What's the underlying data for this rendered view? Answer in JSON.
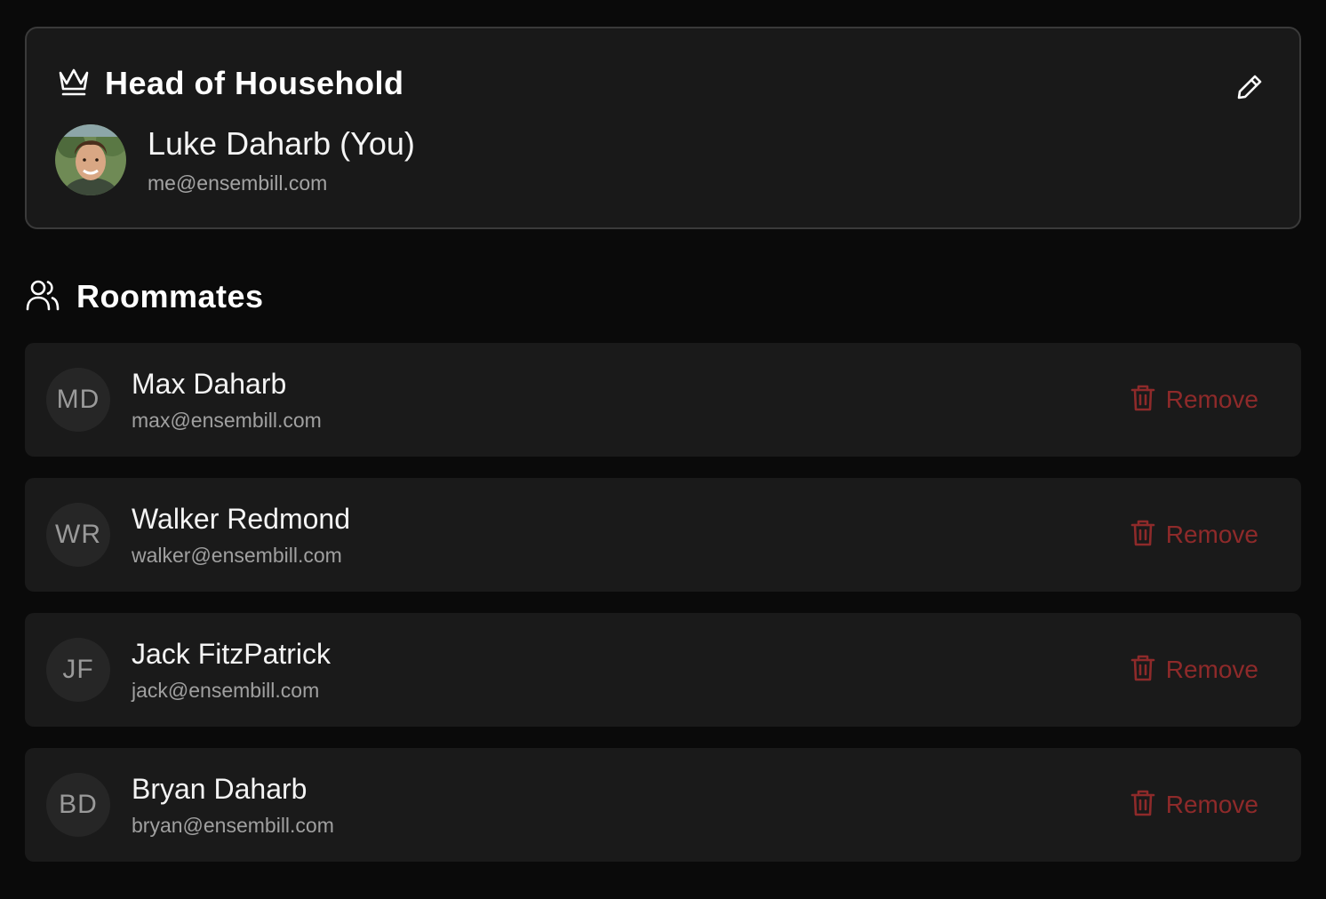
{
  "head": {
    "title": "Head of Household",
    "icon": "crown-icon",
    "edit_icon": "pencil-icon",
    "user": {
      "name": "Luke Daharb (You)",
      "email": "me@ensembill.com"
    }
  },
  "roommates": {
    "title": "Roommates",
    "icon": "users-icon",
    "remove_label": "Remove",
    "items": [
      {
        "initials": "MD",
        "name": "Max Daharb",
        "email": "max@ensembill.com"
      },
      {
        "initials": "WR",
        "name": "Walker Redmond",
        "email": "walker@ensembill.com"
      },
      {
        "initials": "JF",
        "name": "Jack FitzPatrick",
        "email": "jack@ensembill.com"
      },
      {
        "initials": "BD",
        "name": "Bryan Daharb",
        "email": "bryan@ensembill.com"
      }
    ]
  },
  "colors": {
    "background": "#0a0a0a",
    "card": "#1a1a1a",
    "danger": "#8e2a2a",
    "muted_text": "#a0a0a0"
  }
}
